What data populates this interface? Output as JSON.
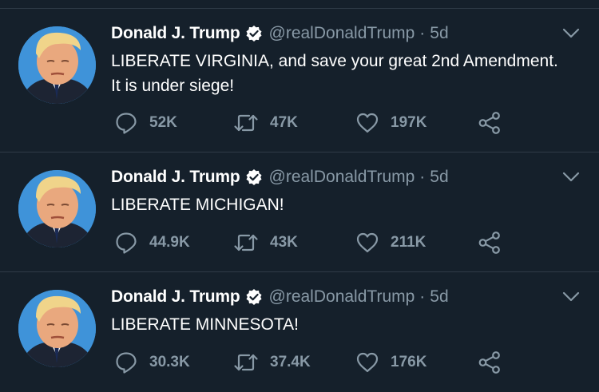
{
  "tweets": [
    {
      "name": "Donald J. Trump",
      "handle": "@realDonaldTrump",
      "separator": "·",
      "time": "5d",
      "text": "LIBERATE VIRGINIA, and save your great 2nd Amendment. It is under siege!",
      "replies": "52K",
      "retweets": "47K",
      "likes": "197K"
    },
    {
      "name": "Donald J. Trump",
      "handle": "@realDonaldTrump",
      "separator": "·",
      "time": "5d",
      "text": "LIBERATE MICHIGAN!",
      "replies": "44.9K",
      "retweets": "43K",
      "likes": "211K"
    },
    {
      "name": "Donald J. Trump",
      "handle": "@realDonaldTrump",
      "separator": "·",
      "time": "5d",
      "text": "LIBERATE MINNESOTA!",
      "replies": "30.3K",
      "retweets": "37.4K",
      "likes": "176K"
    }
  ],
  "icons": {
    "reply": "reply-icon",
    "retweet": "retweet-icon",
    "like": "like-icon",
    "share": "share-icon",
    "verified": "verified-badge-icon",
    "caret": "chevron-down-icon"
  },
  "colors": {
    "background": "#15202b",
    "text": "#ffffff",
    "secondary": "#8899a6",
    "divider": "#2f3b47"
  }
}
